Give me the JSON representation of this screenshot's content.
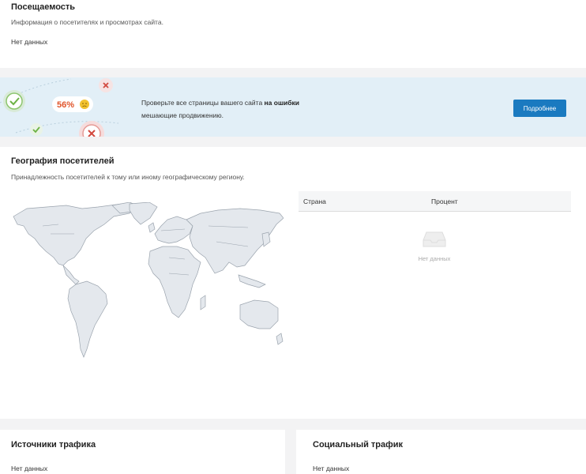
{
  "attendance": {
    "title": "Посещаемость",
    "subtitle": "Информация о посетителях и просмотрах сайта.",
    "empty": "Нет данных"
  },
  "banner": {
    "badge": "56%",
    "text_start": "Проверьте все страницы вашего сайта ",
    "text_bold": "на ошибки",
    "text_line2": "мешающие продвижению.",
    "button_label": "Подробнее",
    "accent_color": "#1a7ac0"
  },
  "geo": {
    "title": "География посетителей",
    "subtitle": "Принадлежность посетителей к тому или иному географическому региону.",
    "table": {
      "col_country": "Страна",
      "col_percent": "Процент",
      "empty": "Нет данных"
    }
  },
  "traffic": {
    "title": "Источники трафика",
    "empty": "Нет данных"
  },
  "social": {
    "title": "Социальный трафик",
    "empty": "Нет данных"
  }
}
